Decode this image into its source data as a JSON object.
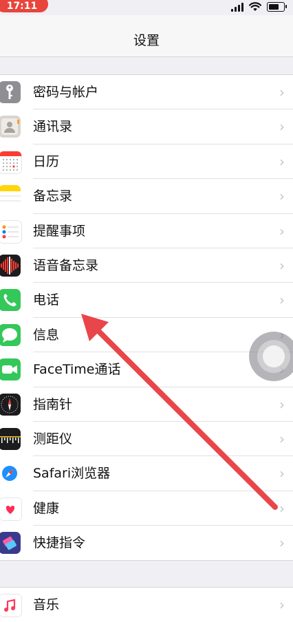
{
  "status": {
    "time": "17:11"
  },
  "nav": {
    "title": "设置"
  },
  "settings_items": [
    {
      "label": "密码与帐户",
      "icon": "key-icon",
      "color": "#8e8e93"
    },
    {
      "label": "通讯录",
      "icon": "contacts-icon",
      "color": "#d9d4cf"
    },
    {
      "label": "日历",
      "icon": "calendar-icon",
      "color": "#ffffff"
    },
    {
      "label": "备忘录",
      "icon": "notes-icon",
      "color": "#ffd60a"
    },
    {
      "label": "提醒事项",
      "icon": "reminders-icon",
      "color": "#ffffff"
    },
    {
      "label": "语音备忘录",
      "icon": "voice-memos-icon",
      "color": "#1c1c1e"
    },
    {
      "label": "电话",
      "icon": "phone-icon",
      "color": "#34c759"
    },
    {
      "label": "信息",
      "icon": "messages-icon",
      "color": "#34c759"
    },
    {
      "label": "FaceTime通话",
      "icon": "facetime-icon",
      "color": "#34c759"
    },
    {
      "label": "指南针",
      "icon": "compass-icon",
      "color": "#1c1c1e"
    },
    {
      "label": "测距仪",
      "icon": "measure-icon",
      "color": "#1c1c1e"
    },
    {
      "label": "Safari浏览器",
      "icon": "safari-icon",
      "color": "#1e90ff"
    },
    {
      "label": "健康",
      "icon": "health-icon",
      "color": "#ffffff"
    },
    {
      "label": "快捷指令",
      "icon": "shortcuts-icon",
      "color": "#3a3a8c"
    }
  ],
  "music_item": {
    "label": "音乐",
    "icon": "music-icon",
    "color": "#ff3b5c"
  },
  "chevron": "›",
  "annotation_color": "#e8464b"
}
